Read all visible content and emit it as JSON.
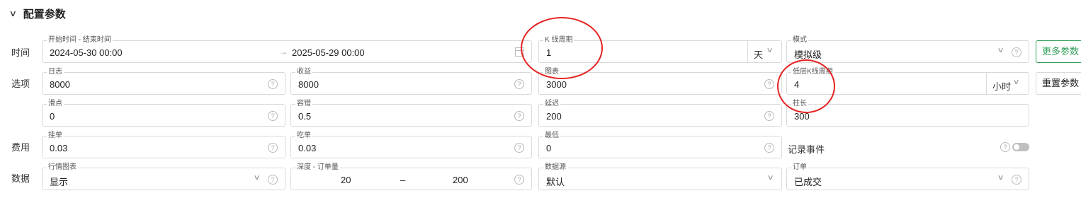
{
  "section": {
    "title": "配置参数"
  },
  "rows": {
    "time": "时间",
    "options": "选项",
    "fees": "费用",
    "data": "数据"
  },
  "time": {
    "range_label": "开始时间 - 结束时间",
    "start": "2024-05-30 00:00",
    "end": "2025-05-29 00:00",
    "kperiod_label": "K 线周期",
    "kperiod_value": "1",
    "kperiod_unit": "天",
    "mode_label": "模式",
    "mode_value": "模拟级",
    "more_button": "更多参数 ▴"
  },
  "options": {
    "log_label": "日志",
    "log_value": "8000",
    "profit_label": "收益",
    "profit_value": "8000",
    "chart_label": "图表",
    "chart_value": "3000",
    "lowk_label": "低层K线周期",
    "lowk_value": "4",
    "lowk_unit": "小时",
    "reset_button": "重置参数",
    "slip_label": "滑点",
    "slip_value": "0",
    "tolerance_label": "容错",
    "tolerance_value": "0.5",
    "delay_label": "延迟",
    "delay_value": "200",
    "bar_label": "柱长",
    "bar_value": "300"
  },
  "fees": {
    "maker_label": "挂单",
    "maker_value": "0.03",
    "taker_label": "吃单",
    "taker_value": "0.03",
    "min_label": "最低",
    "min_value": "0",
    "record_label": "记录事件"
  },
  "data": {
    "chart_label": "行情图表",
    "chart_value": "显示",
    "depth_label": "深度 - 订单量",
    "depth_min": "20",
    "depth_sep": "–",
    "depth_max": "200",
    "source_label": "数据源",
    "source_value": "默认",
    "order_label": "订单",
    "order_value": "已成交"
  },
  "colors": {
    "accent": "#2e9e5a",
    "annotation": "#e52222"
  }
}
